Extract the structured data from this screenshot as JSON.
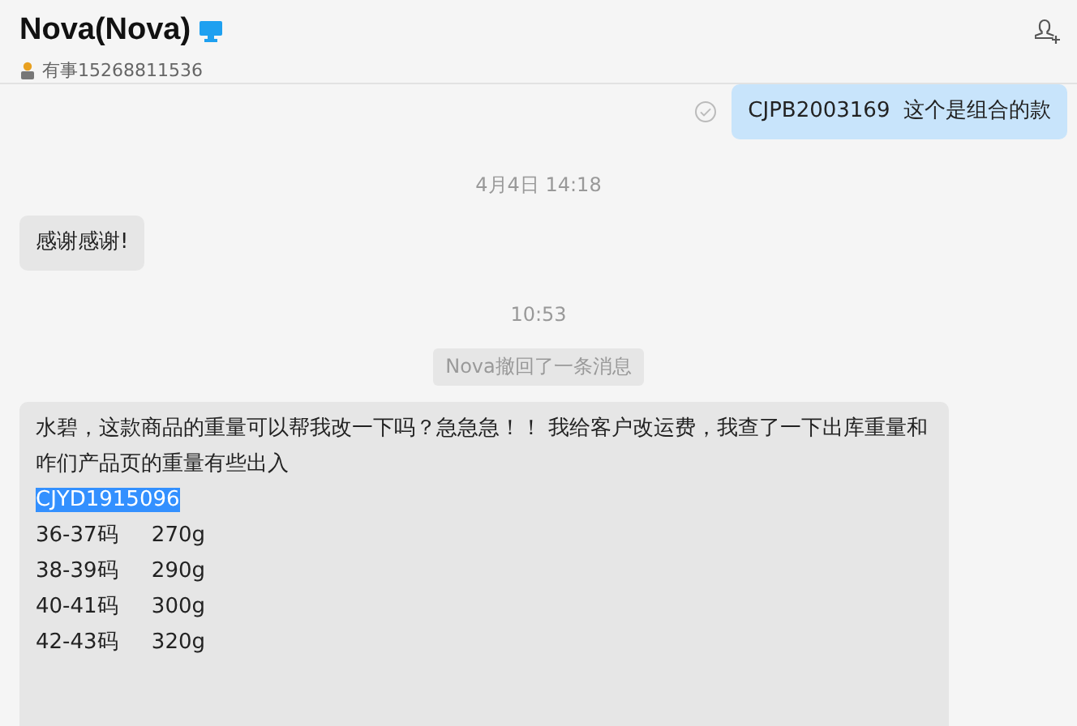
{
  "header": {
    "title": "Nova(Nova)",
    "status": "有事15268811536"
  },
  "messages": [
    {
      "kind": "outgoing",
      "read": true,
      "lines": [
        {
          "text": "CJPB2003169  这个是组合的款",
          "selected": false
        }
      ]
    },
    {
      "kind": "time",
      "text": "4月4日 14:18"
    },
    {
      "kind": "incoming",
      "lines": [
        {
          "text": "感谢感谢!",
          "selected": false
        }
      ]
    },
    {
      "kind": "time",
      "text": "10:53"
    },
    {
      "kind": "notice",
      "text": "Nova撤回了一条消息"
    },
    {
      "kind": "incoming",
      "lines": [
        {
          "text": "水碧，这款商品的重量可以帮我改一下吗？急急急！！ 我给客户改运费，我查了一下出库重量和咋们产品页的重量有些出入",
          "selected": false
        },
        {
          "text": "CJYD1915096",
          "selected": true
        },
        {
          "text": "36-37码     270g",
          "selected": false
        },
        {
          "text": "38-39码     290g",
          "selected": false
        },
        {
          "text": "40-41码     300g",
          "selected": false
        },
        {
          "text": "42-43码     320g",
          "selected": false
        }
      ]
    }
  ]
}
